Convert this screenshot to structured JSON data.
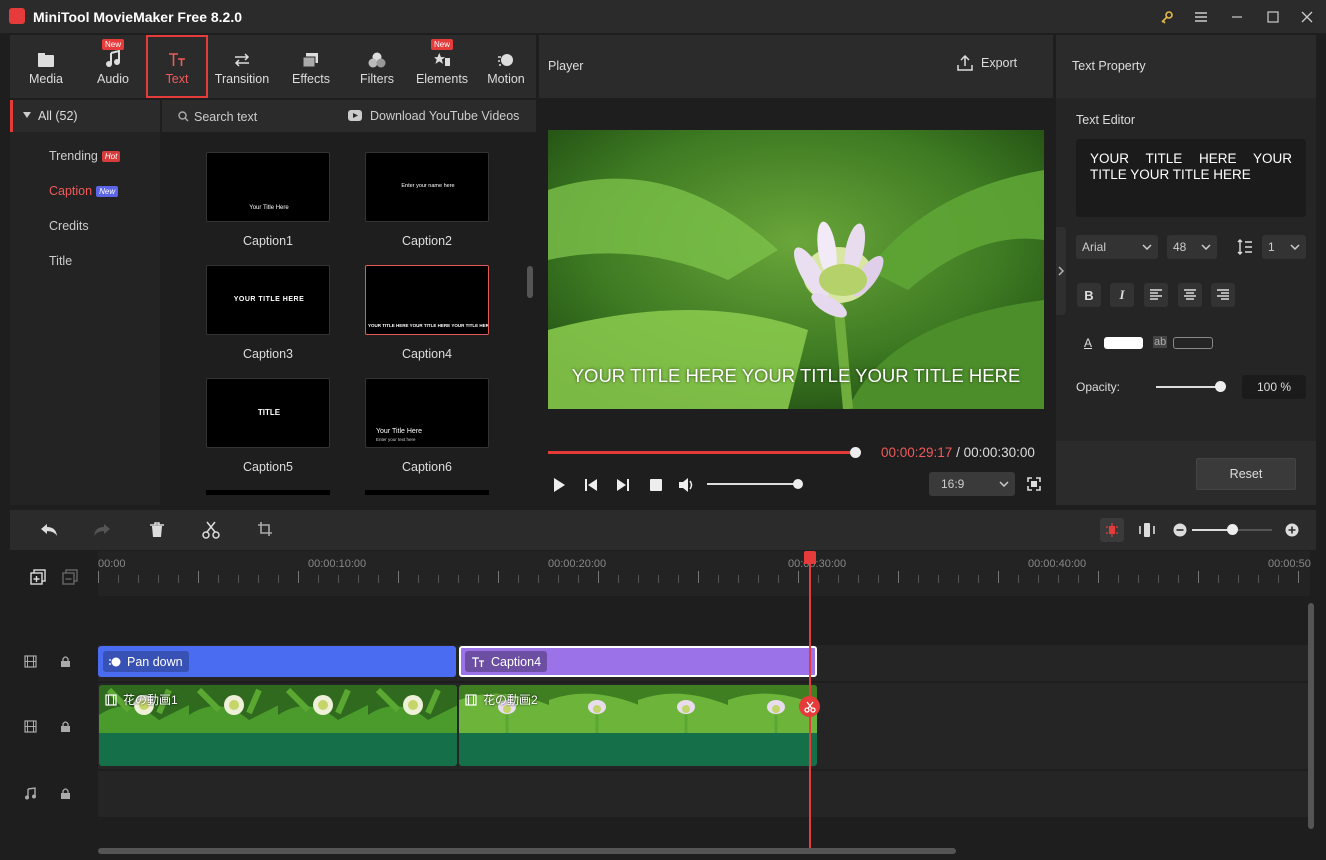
{
  "app": {
    "title": "MiniTool MovieMaker Free 8.2.0"
  },
  "toolbar": {
    "items": [
      {
        "label": "Media",
        "icon": "media-icon"
      },
      {
        "label": "Audio",
        "icon": "audio-icon",
        "badge": "New"
      },
      {
        "label": "Text",
        "icon": "text-icon"
      },
      {
        "label": "Transition",
        "icon": "transition-icon"
      },
      {
        "label": "Effects",
        "icon": "effects-icon"
      },
      {
        "label": "Filters",
        "icon": "filters-icon"
      },
      {
        "label": "Elements",
        "icon": "elements-icon",
        "badge": "New"
      },
      {
        "label": "Motion",
        "icon": "motion-icon"
      }
    ],
    "active": "Text"
  },
  "categories": {
    "all_label": "All (52)",
    "items": [
      {
        "label": "Trending",
        "badge": "Hot"
      },
      {
        "label": "Caption",
        "badge": "New"
      },
      {
        "label": "Credits"
      },
      {
        "label": "Title"
      }
    ]
  },
  "library": {
    "search_placeholder": "Search text",
    "download_label": "Download YouTube Videos",
    "thumbs": [
      {
        "label": "Caption1",
        "preview": "Your Title Here"
      },
      {
        "label": "Caption2",
        "preview": "Enter your name here"
      },
      {
        "label": "Caption3",
        "preview": "YOUR TITLE HERE"
      },
      {
        "label": "Caption4",
        "preview": "YOUR TITLE HERE YOUR TITLE HERE YOUR TITLE HERE"
      },
      {
        "label": "Caption5",
        "preview": "TITLE"
      },
      {
        "label": "Caption6",
        "preview": "Your Title Here",
        "preview2": "Enter your text here"
      }
    ]
  },
  "player": {
    "title": "Player",
    "export_label": "Export",
    "overlay_text": "YOUR TITLE HERE YOUR TITLE YOUR TITLE HERE",
    "current_time": "00:00:29:17",
    "total_time": "/ 00:00:30:00",
    "progress": 0.99,
    "volume": 0.97,
    "aspect": "16:9"
  },
  "property": {
    "title": "Text Property",
    "editor_label": "Text Editor",
    "editor_text": "YOUR TITLE HERE YOUR TITLE YOUR TITLE HERE",
    "font": "Arial",
    "size": "48",
    "line_spacing": "1",
    "opacity_label": "Opacity:",
    "opacity_value": "100 %",
    "opacity": 1.0,
    "reset_label": "Reset",
    "text_color_label": "A",
    "bg_color_label": "ab"
  },
  "timeline": {
    "ruler_labels": [
      "00:00",
      "00:00:10:00",
      "00:00:20:00",
      "00:00:30:00",
      "00:00:40:00",
      "00:00:50"
    ],
    "clips": {
      "effect": "Pan down",
      "caption": "Caption4",
      "video1": "花の動画1",
      "video2": "花の動画2"
    },
    "zoom": 0.5
  },
  "colors": {
    "accent": "#e53b3b",
    "effect_clip": "#4a6cf0",
    "caption_clip": "#9b72e8",
    "audio_band": "#15704a"
  }
}
